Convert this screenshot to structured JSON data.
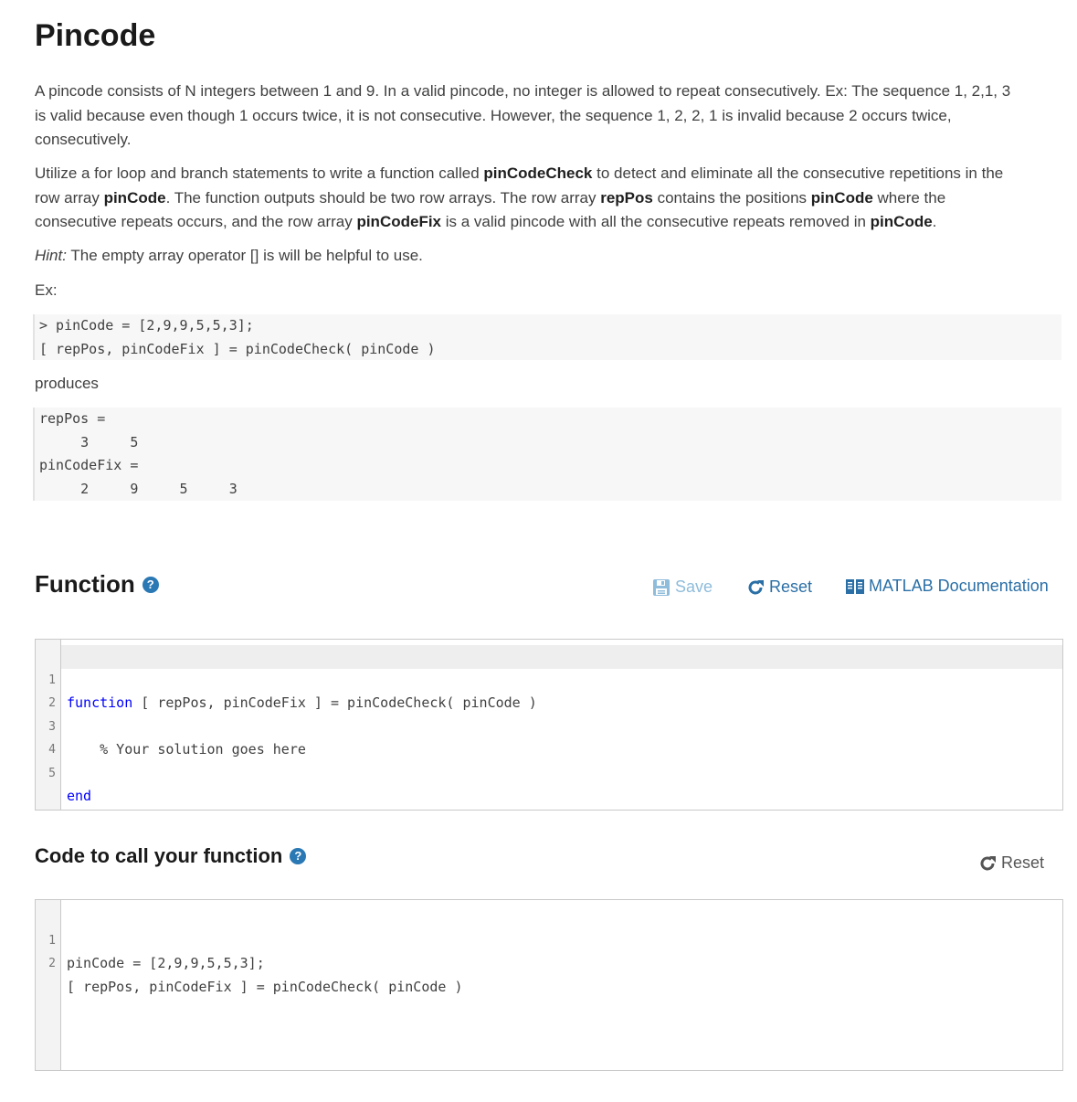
{
  "title": "Pincode",
  "description": {
    "p1": "A pincode consists of N integers between 1 and 9. In a valid pincode, no integer is allowed to repeat consecutively.  Ex: The sequence 1, 2,1, 3 is valid because even though 1 occurs twice, it is not consecutive. However, the sequence 1, 2, 2, 1 is invalid because 2 occurs twice, consecutively.",
    "p2": [
      {
        "t": "Utilize a for loop and branch statements to write a function called ",
        "b": false
      },
      {
        "t": "pinCodeCheck",
        "b": true
      },
      {
        "t": " to detect and eliminate all the consecutive repetitions in the row array ",
        "b": false
      },
      {
        "t": "pinCode",
        "b": true
      },
      {
        "t": ".  The function outputs should be two row arrays.  The row array ",
        "b": false
      },
      {
        "t": "repPos",
        "b": true
      },
      {
        "t": " contains the positions ",
        "b": false
      },
      {
        "t": "pinCode",
        "b": true
      },
      {
        "t": " where the consecutive repeats occurs, and the row array ",
        "b": false
      },
      {
        "t": "pinCodeFix",
        "b": true
      },
      {
        "t": " is a valid pincode with all the consecutive repeats removed in ",
        "b": false
      },
      {
        "t": "pinCode",
        "b": true
      },
      {
        "t": ".",
        "b": false
      }
    ],
    "hint_label": "Hint:",
    "hint_text": "  The empty array operator [] is will be helpful to use.",
    "ex_label": "Ex:",
    "example_code": [
      "> pinCode = [2,9,9,5,5,3];",
      "[ repPos, pinCodeFix ] = pinCodeCheck( pinCode )"
    ],
    "produces_label": "produces",
    "example_output": [
      "repPos =",
      "     3     5",
      "pinCodeFix =",
      "     2     9     5     3"
    ]
  },
  "function_section": {
    "title": "Function",
    "save_label": "Save",
    "reset_label": "Reset",
    "docs_label": "MATLAB Documentation",
    "lines": [
      {
        "n": "1",
        "kw": "function",
        "rest": " [ repPos, pinCodeFix ] = pinCodeCheck( pinCode )"
      },
      {
        "n": "2",
        "code": ""
      },
      {
        "n": "3",
        "comment": "    % Your solution goes here"
      },
      {
        "n": "4",
        "code": ""
      },
      {
        "n": "5",
        "kw": "end",
        "rest": ""
      }
    ]
  },
  "call_section": {
    "title": "Code to call your function",
    "reset_label": "Reset",
    "lines": [
      {
        "n": "1",
        "code": "pinCode = [2,9,9,5,5,3];"
      },
      {
        "n": "2",
        "code": "[ repPos, pinCodeFix ] = pinCodeCheck( pinCode )"
      }
    ]
  },
  "colors": {
    "accent": "#2a78b4",
    "save_disabled": "#8fbcdb",
    "keyword": "#0000ff",
    "comment": "#228b22",
    "reset_gray": "#555555"
  }
}
